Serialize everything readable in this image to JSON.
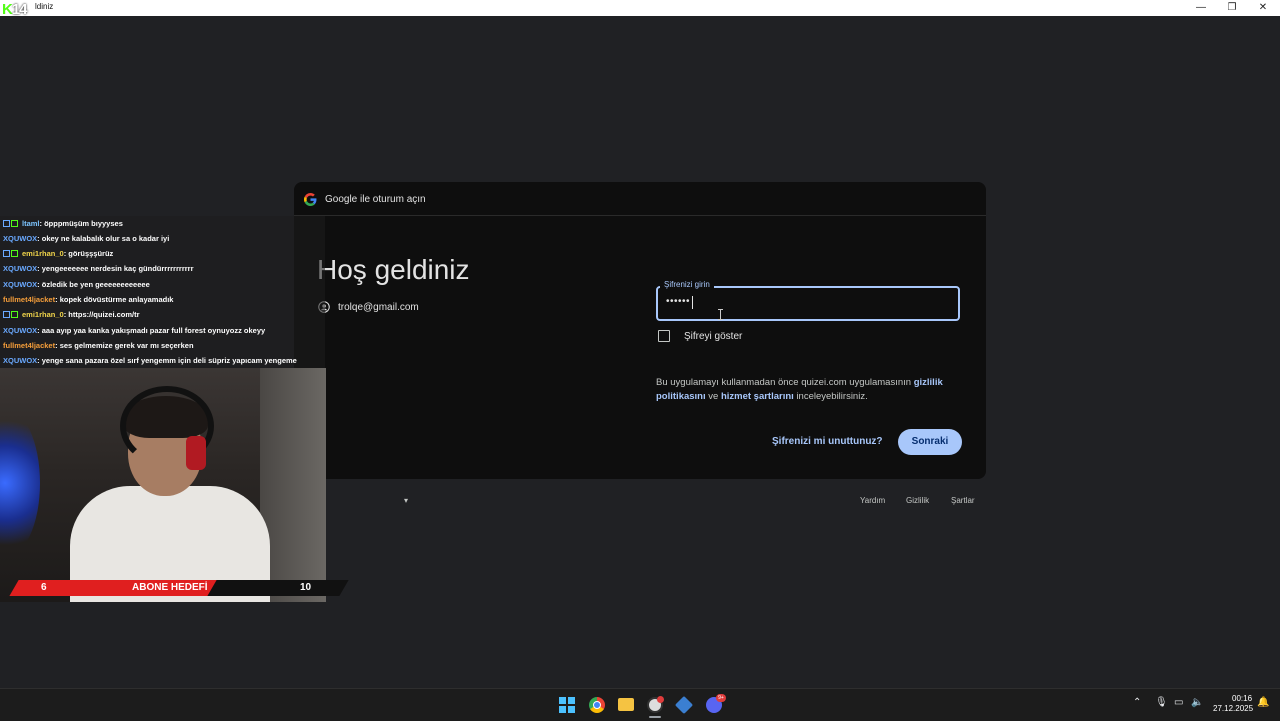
{
  "window": {
    "title_partial": "ldiniz",
    "minimize_icon": "minimize-icon",
    "maximize_icon": "restore-icon",
    "close_icon": "close-icon"
  },
  "kick_logo": {
    "k": "K",
    "num": "14"
  },
  "signin": {
    "header": "Google ile oturum açın",
    "welcome": "Hoş geldiniz",
    "account_email": "trolqe@gmail.com",
    "password_label": "Şifrenizi girin",
    "password_value": "••••••",
    "show_password_label": "Şifreyi göster",
    "show_password_checked": false,
    "terms_prefix": "Bu uygulamayı kullanmadan önce quizei.com uygulamasının ",
    "privacy_link": "gizlilik politikasını",
    "terms_middle": " ve ",
    "terms_link": "hizmet şartlarını",
    "terms_suffix": " inceleyebilirsiniz.",
    "forgot_button": "Şifrenizi mi unuttunuz?",
    "next_button": "Sonraki",
    "accent_color": "#a8c7fa"
  },
  "footer": {
    "language_caret": "▾",
    "help": "Yardım",
    "privacy": "Gizlilik",
    "terms": "Şartlar"
  },
  "chat": [
    {
      "user": "ltaml",
      "color": "#7cc4ff",
      "badges": true,
      "message": ": öpppmüşüm bıyyyses"
    },
    {
      "user": "XQUWOX",
      "color": "#6aa9ff",
      "badges": false,
      "message": ": okey ne kalabalık olur sa o kadar iyi"
    },
    {
      "user": "emi1rhan_0",
      "color": "#f0d44a",
      "badges": true,
      "message": ": görüşşşürüz"
    },
    {
      "user": "XQUWOX",
      "color": "#6aa9ff",
      "badges": false,
      "message": ": yengeeeeeee nerdesin kaç gündürrrrrrrrrrr"
    },
    {
      "user": "XQUWOX",
      "color": "#6aa9ff",
      "badges": false,
      "message": ": özledik be yen geeeeeeeeeeee"
    },
    {
      "user": "fullmet4ljacket",
      "color": "#f59e3a",
      "badges": false,
      "message": ": kopek dövüstürme anlayamadık"
    },
    {
      "user": "emi1rhan_0",
      "color": "#f0d44a",
      "badges": true,
      "message": ": https://quizei.com/tr"
    },
    {
      "user": "XQUWOX",
      "color": "#6aa9ff",
      "badges": false,
      "message": ": aaa ayıp yaa kanka yakışmadı pazar full forest oynuyozz okeyy"
    },
    {
      "user": "fullmet4ljacket",
      "color": "#f59e3a",
      "badges": false,
      "message": ": ses gelmemize gerek var mı seçerken"
    },
    {
      "user": "XQUWOX",
      "color": "#6aa9ff",
      "badges": false,
      "message": ": yenge sana pazara özel sırf yengemm için deli süpriz yapıcam yengeme"
    }
  ],
  "sub_goal": {
    "current": "6",
    "label": "ABONE HEDEFİ",
    "target": "10",
    "progress_fraction": 0.6
  },
  "taskbar": {
    "apps": [
      "windows-start-icon",
      "chrome-icon",
      "file-explorer-icon",
      "obs-icon",
      "app-icon",
      "discord-icon"
    ],
    "discord_badge": "9+",
    "time": "00:16",
    "date": "27.12.2025"
  }
}
